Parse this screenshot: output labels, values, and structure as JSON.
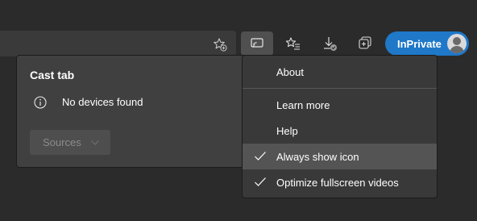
{
  "toolbar": {
    "icons": {
      "add_favorite": "star-plus-icon",
      "cast": "cast-icon",
      "favorites": "favorites-list-icon",
      "downloads": "download-icon",
      "collections": "collections-icon"
    },
    "inprivate_label": "InPrivate",
    "avatar": "profile-avatar"
  },
  "cast_panel": {
    "title": "Cast tab",
    "status_icon": "info-icon",
    "status_text": "No devices found",
    "sources_label": "Sources",
    "sources_icon": "chevron-down-icon"
  },
  "context_menu": {
    "items": [
      {
        "label": "About",
        "checked": false
      },
      {
        "label": "Learn more",
        "checked": false
      },
      {
        "label": "Help",
        "checked": false
      },
      {
        "label": "Always show icon",
        "checked": true
      },
      {
        "label": "Optimize fullscreen videos",
        "checked": true
      }
    ]
  },
  "colors": {
    "accent": "#1f78c8",
    "panel_bg": "#404040",
    "menu_bg": "#393939",
    "menu_hover": "#545454"
  }
}
